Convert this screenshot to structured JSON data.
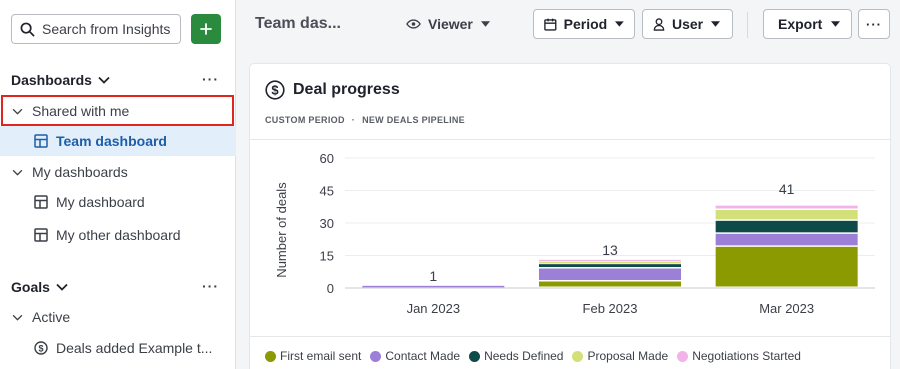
{
  "sidebar": {
    "search_placeholder": "Search from Insights",
    "dashboards_label": "Dashboards",
    "dashboards_more": "···",
    "shared_label": "Shared with me",
    "team_dashboard": "Team dashboard",
    "my_dashboards_label": "My dashboards",
    "my_dashboard": "My dashboard",
    "my_other_dashboard": "My other dashboard",
    "goals_label": "Goals",
    "goals_more": "···",
    "active_label": "Active",
    "goal_item": "Deals added Example t..."
  },
  "topbar": {
    "title": "Team das...",
    "viewer_label": "Viewer",
    "period_label": "Period",
    "user_label": "User",
    "export_label": "Export",
    "more_label": "···"
  },
  "card": {
    "title": "Deal progress",
    "sub_period": "CUSTOM PERIOD",
    "sub_sep": "·",
    "sub_pipeline": "NEW DEALS PIPELINE"
  },
  "colors": {
    "first_email": "#8a9a00",
    "contact_made": "#9c7fd6",
    "needs_defined": "#0e4a47",
    "proposal_made": "#d3e07a",
    "negotiations": "#f1b3e8"
  },
  "chart_data": {
    "type": "bar",
    "stacked": true,
    "categories": [
      "Jan 2023",
      "Feb 2023",
      "Mar 2023"
    ],
    "totals": [
      1,
      13,
      41
    ],
    "ylabel": "Number of deals",
    "yticks": [
      0,
      15,
      30,
      45,
      60
    ],
    "ylim": [
      0,
      60
    ],
    "series": [
      {
        "name": "First email sent",
        "color": "#8a9a00",
        "values": [
          0,
          3,
          19
        ]
      },
      {
        "name": "Contact Made",
        "color": "#9c7fd6",
        "values": [
          1,
          6,
          6
        ]
      },
      {
        "name": "Needs Defined",
        "color": "#0e4a47",
        "values": [
          0,
          2,
          6
        ]
      },
      {
        "name": "Proposal Made",
        "color": "#d3e07a",
        "values": [
          0,
          1,
          5
        ]
      },
      {
        "name": "Negotiations Started",
        "color": "#f1b3e8",
        "values": [
          0,
          1,
          2
        ]
      }
    ],
    "legend_position": "bottom"
  }
}
